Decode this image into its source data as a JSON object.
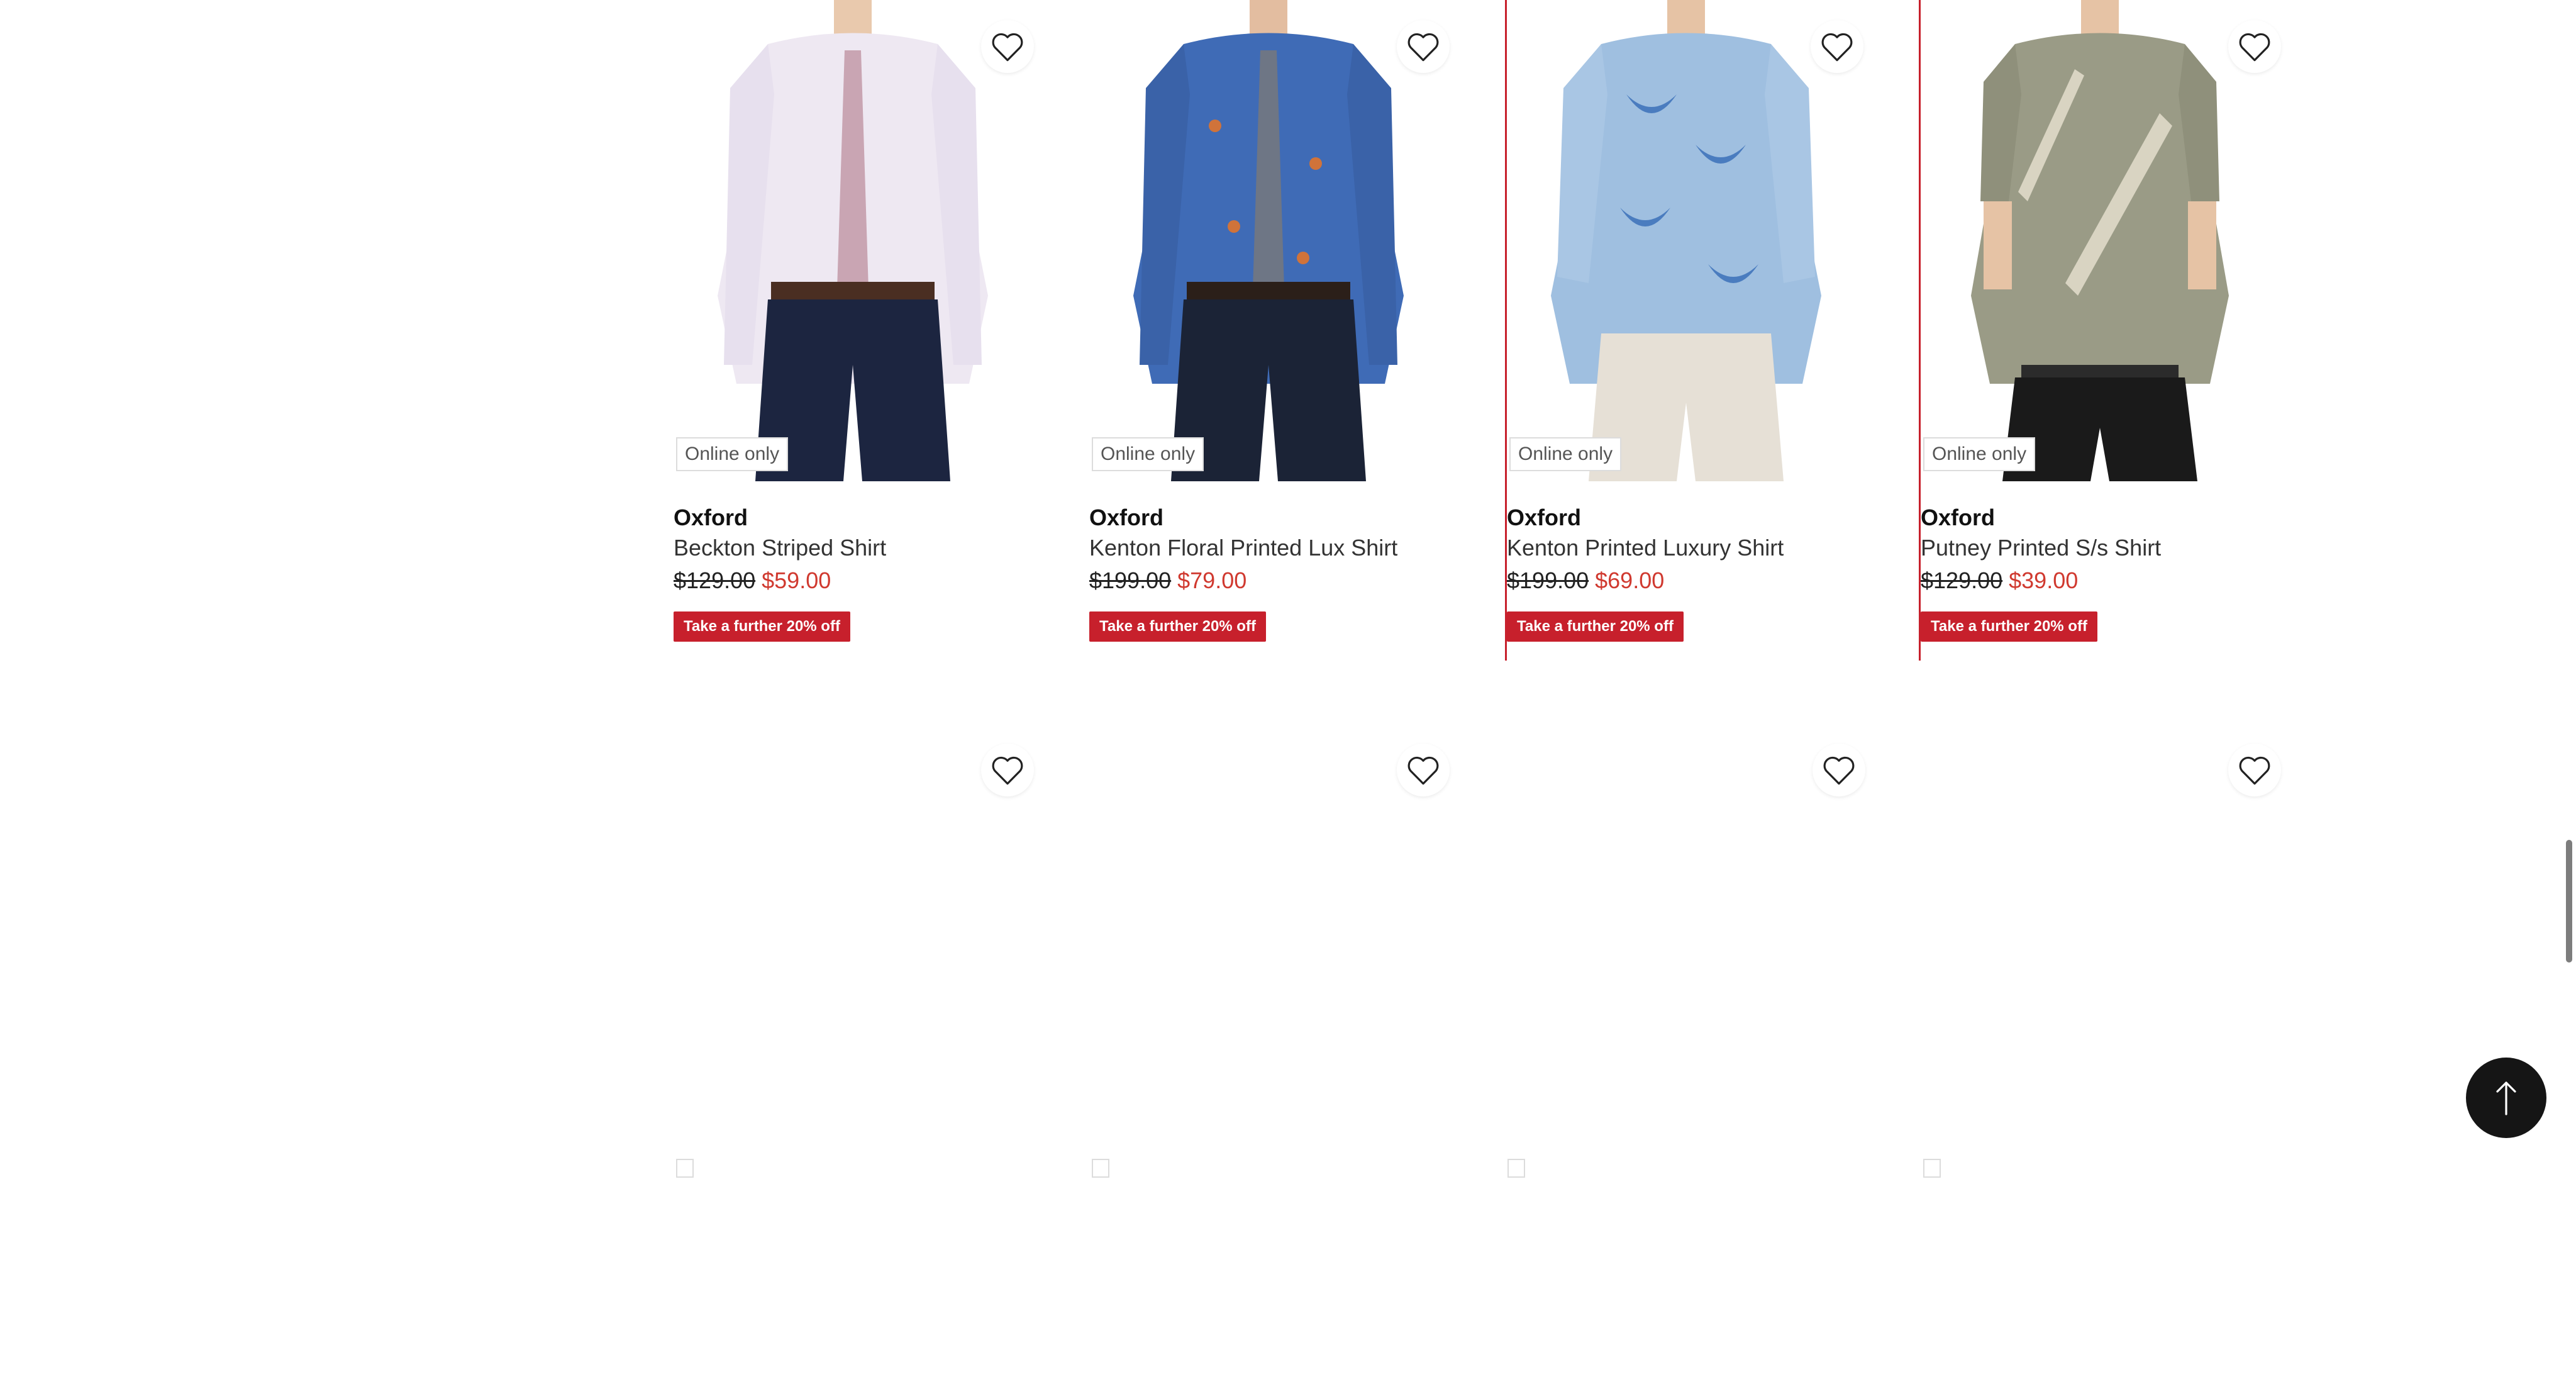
{
  "products": [
    {
      "badge": "Online only",
      "brand": "Oxford",
      "name": "Beckton Striped Shirt",
      "old_price": "$129.00",
      "new_price": "$59.00",
      "promo": "Take a further 20% off",
      "shirt_color": "#eee8f2",
      "trouser_color": "#1c2540",
      "tie": true
    },
    {
      "badge": "Online only",
      "brand": "Oxford",
      "name": "Kenton Floral Printed Lux Shirt",
      "old_price": "$199.00",
      "new_price": "$79.00",
      "promo": "Take a further 20% off",
      "shirt_color": "#3f6bb6",
      "trouser_color": "#1b2336",
      "tie": true
    },
    {
      "badge": "Online only",
      "brand": "Oxford",
      "name": "Kenton Printed Luxury Shirt",
      "old_price": "$199.00",
      "new_price": "$69.00",
      "promo": "Take a further 20% off",
      "shirt_color": "#9fbfe0",
      "trouser_color": "#e6e0d6",
      "tie": false
    },
    {
      "badge": "Online only",
      "brand": "Oxford",
      "name": "Putney Printed S/s Shirt",
      "old_price": "$129.00",
      "new_price": "$39.00",
      "promo": "Take a further 20% off",
      "shirt_color": "#9a9b86",
      "trouser_color": "#1a1a1a",
      "tie": false
    }
  ],
  "colors": {
    "accent": "#c7202c",
    "sale_price": "#d0392f",
    "back_to_top_bg": "#151515"
  },
  "icons": {
    "favorite": "heart-outline-icon",
    "back_to_top": "arrow-up-icon"
  }
}
